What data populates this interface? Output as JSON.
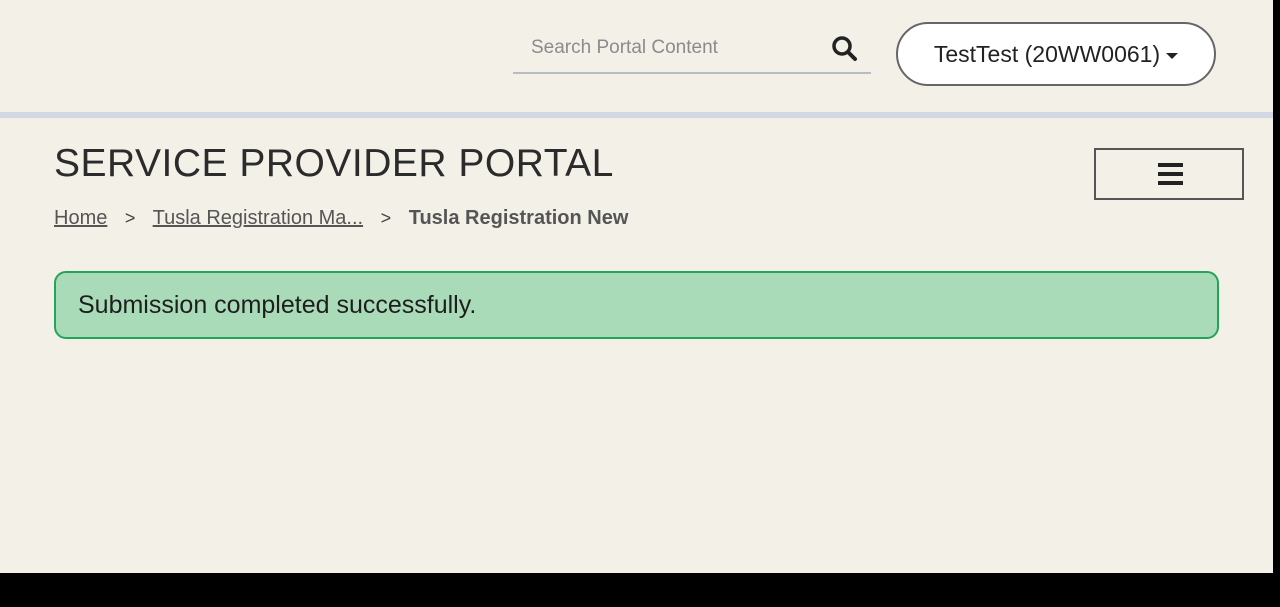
{
  "header": {
    "search": {
      "placeholder": "Search Portal Content",
      "value": ""
    },
    "user_button_label": "TestTest (20WW0061)"
  },
  "portal_title": "SERVICE PROVIDER PORTAL",
  "breadcrumb": {
    "items": [
      {
        "label": "Home"
      },
      {
        "label": "Tusla Registration Ma..."
      }
    ],
    "separator": ">",
    "current": "Tusla Registration New"
  },
  "alert": {
    "message": "Submission completed successfully.",
    "background": "#aadbb8",
    "border": "#22a558"
  },
  "icons": {
    "search": "search-icon",
    "menu": "hamburger-menu-icon",
    "dropdown": "caret-down-icon"
  }
}
